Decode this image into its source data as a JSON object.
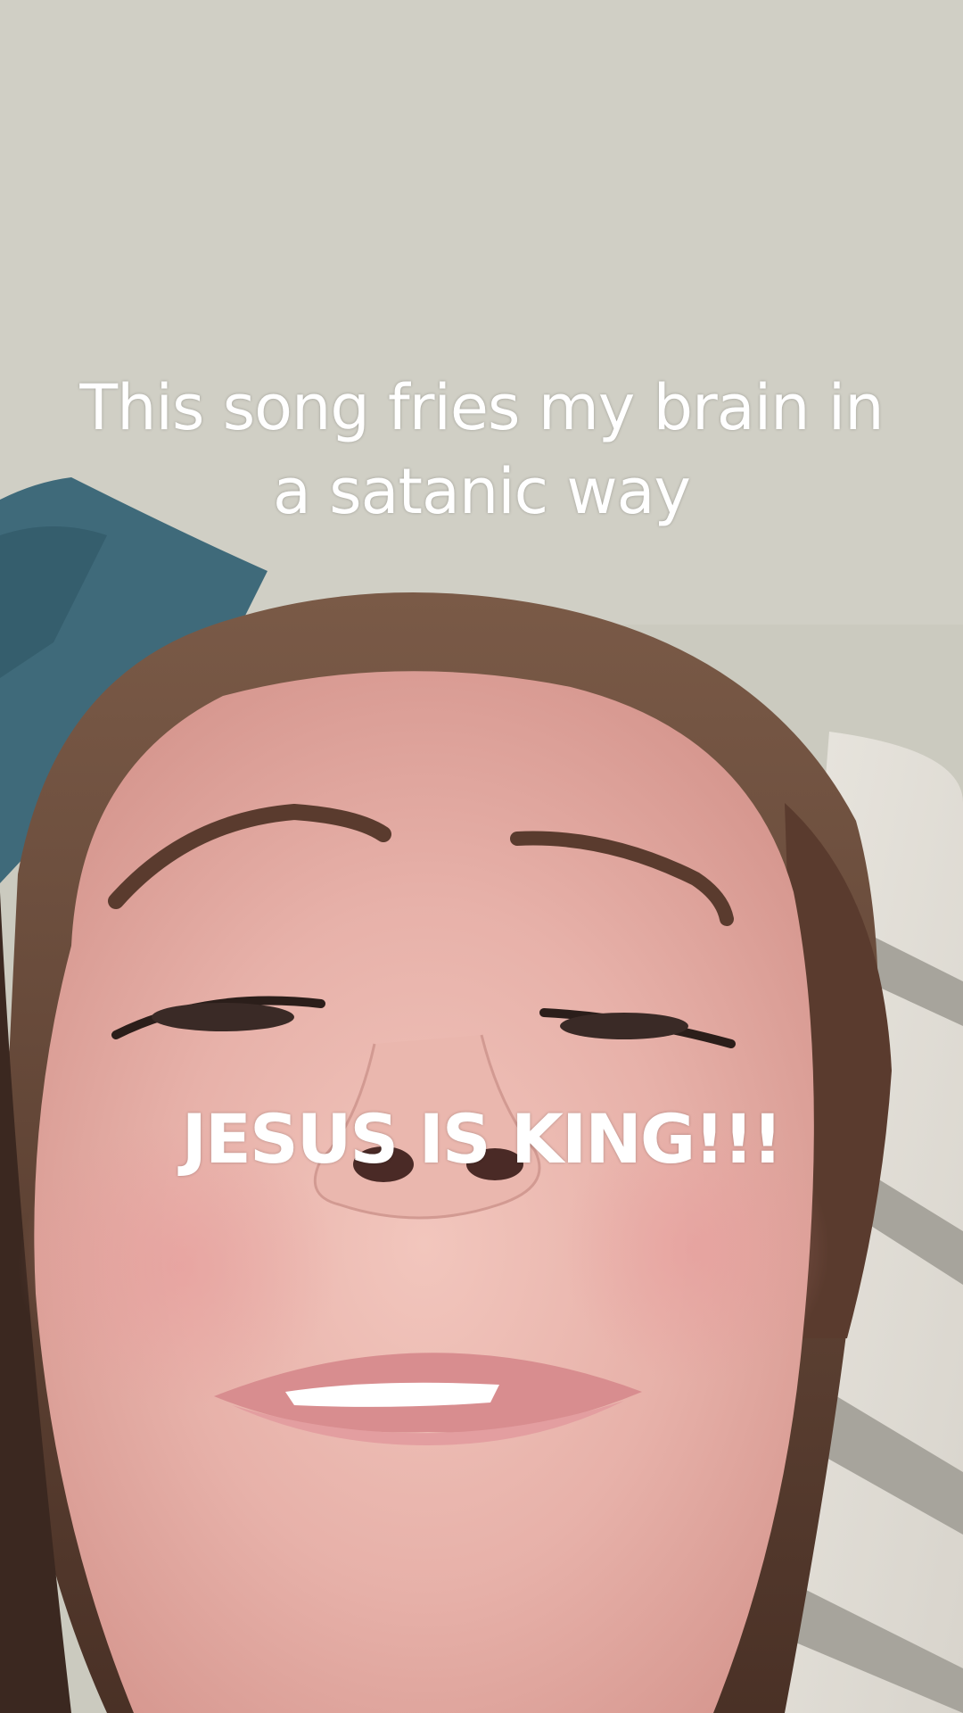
{
  "video": {
    "caption_top": "This song fries my brain in a satanic way",
    "caption_middle": "JESUS IS KING!!!"
  },
  "colors": {
    "wall": "#cbcabf",
    "blanket": "#3f6a7a",
    "hair": "#6a4a3a",
    "skin": "#e8b7b0",
    "caption_text": "#ffffff"
  }
}
